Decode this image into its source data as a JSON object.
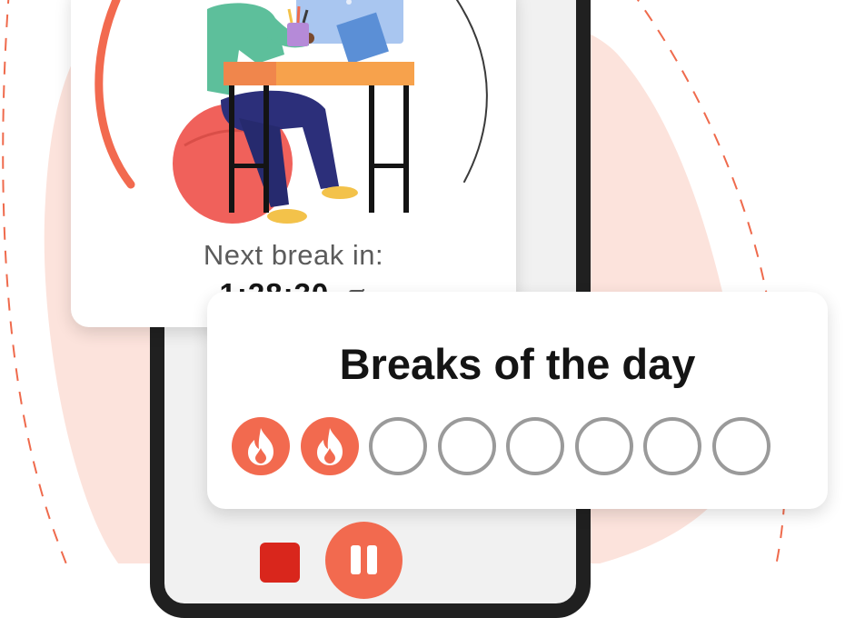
{
  "timer": {
    "next_break_label": "Next break in:",
    "countdown": "1:28:30",
    "edit_icon": "edit-icon"
  },
  "breaks": {
    "title": "Breaks of the day",
    "total": 8,
    "completed": 2,
    "completed_icon": "flame-icon"
  },
  "controls": {
    "stop_icon": "stop-icon",
    "pause_icon": "pause-icon"
  },
  "colors": {
    "accent": "#f26a4f",
    "background_blob": "#fce3dc",
    "empty_dot": "#9a9a9a"
  }
}
